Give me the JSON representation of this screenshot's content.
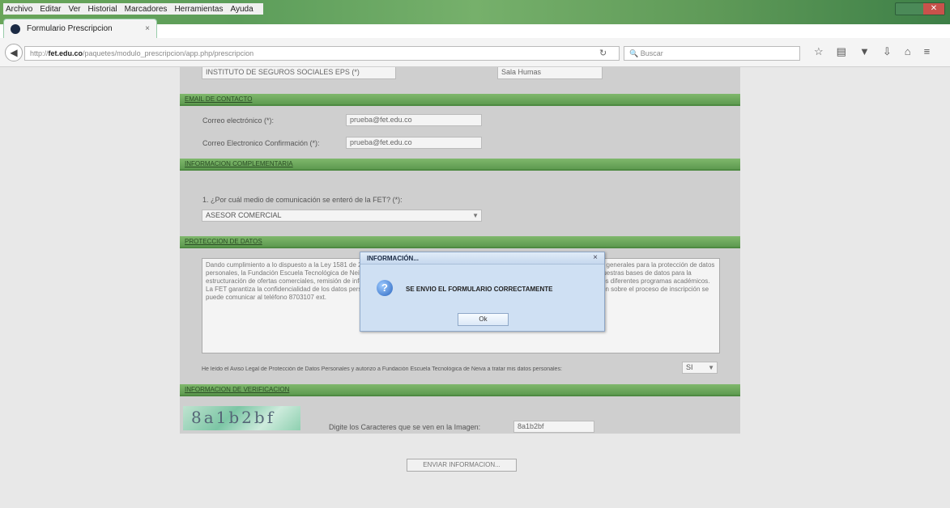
{
  "browser": {
    "menu": [
      "Archivo",
      "Editar",
      "Ver",
      "Historial",
      "Marcadores",
      "Herramientas",
      "Ayuda"
    ],
    "tab_title": "Formulario Prescripcion",
    "tab_close": "×",
    "new_tab": "+",
    "url_prefix": "http://",
    "url_domain": "fet.edu.co",
    "url_rest": "/paquetes/modulo_prescripcion/app.php/prescripcion",
    "search_placeholder": "Buscar",
    "window_close": "✕"
  },
  "form": {
    "top_value_left": "INSTITUTO DE SEGUROS SOCIALES EPS (*)",
    "top_value_right": "Sala Humas",
    "email_section": "EMAIL DE CONTACTO",
    "email_label": "Correo electrónico (*):",
    "email_value": "prueba@fet.edu.co",
    "email_confirm_label": "Correo Electronico Confirmación (*):",
    "email_confirm_value": "prueba@fet.edu.co",
    "complementary_section": "INFORMACION COMPLEMENTARIA",
    "question": "1. ¿Por cuál medio de comunicación se enteró de la FET? (*):",
    "question_value": "ASESOR COMERCIAL",
    "data_protection_section": "PROTECCION DE DATOS",
    "data_protection_text": "Dando cumplimiento a lo dispuesto a la Ley 1581 de 2012 y su decreto reglamentario 1377 de 2013, por la cual se dictan las disposiciones generales para la protección de datos personales, la Fundación Escuela Tecnológica de Neiva Jesús Oviedo Pérez FET, informa que los datos recolectados serán incluidos en nuestras bases de datos para la estructuración de ofertas comerciales, remisión de información académica y demás actividades propias de nuestra institución referente a los diferentes programas académicos. La FET garantiza la confidencialidad de los datos personales no los divulgará ni expondrá por ningún tipo de medio. Para mayor información sobre el proceso de inscripción se puede comunicar al teléfono 8703107 ext.",
    "accept_text": "He leído el Aviso Legal de Protección de Datos Personales y autorizo a Fundación Escuela Tecnológica de Neiva a tratar mis datos personales:",
    "accept_value": "SI",
    "verification_section": "INFORMACION DE VERIFICACION",
    "captcha_text": "8a1b2bf",
    "captcha_label": "Digite los Caracteres que se ven en la Imagen:",
    "captcha_value": "8a1b2bf",
    "send_button": "ENVIAR INFORMACION..."
  },
  "dialog": {
    "title": "INFORMACIÓN...",
    "close": "×",
    "message": "SE ENVIO EL FORMULARIO CORRECTAMENTE",
    "ok": "Ok"
  }
}
